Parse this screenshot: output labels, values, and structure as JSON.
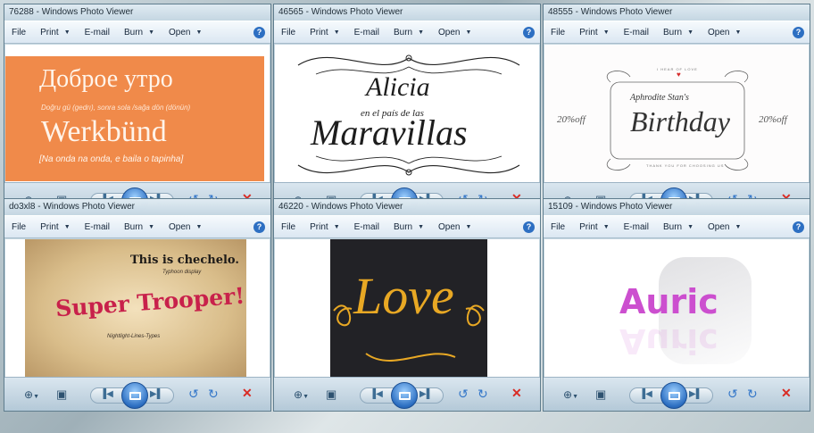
{
  "windows": [
    {
      "title": "76288 - Windows Photo Viewer",
      "menu": [
        "File",
        "Print",
        "E-mail",
        "Burn",
        "Open"
      ],
      "art": {
        "line1": "Доброе утро",
        "line2": "Doğru gü (gedrı), sonra sola /sağa dön (dönün)",
        "line3": "Werkbünd",
        "line4": "[Na onda na onda, e baila o tapinha]"
      }
    },
    {
      "title": "46565 - Windows Photo Viewer",
      "menu": [
        "File",
        "Print",
        "E-mail",
        "Burn",
        "Open"
      ],
      "art": {
        "line1": "Alicia",
        "line2": "en el país de las",
        "line3": "Maravillas"
      }
    },
    {
      "title": "48555 - Windows Photo Viewer",
      "menu": [
        "File",
        "Print",
        "E-mail",
        "Burn",
        "Open"
      ],
      "art": {
        "top": "I HEAR OF LOVE",
        "heart": "♥",
        "names": "Aphrodite Stan's",
        "main": "Birthday",
        "left": "20%off",
        "right": "20%off",
        "thanks": "THANK YOU FOR CHOOSING US"
      }
    },
    {
      "title": "do3xl8 - Windows Photo Viewer",
      "menu": [
        "File",
        "Print",
        "E-mail",
        "Burn",
        "Open"
      ],
      "art": {
        "line1": "This is chechelo.",
        "line2": "Typhoon display",
        "line3": "Super Trooper!",
        "line4": "Nightlight-Lines-Types"
      }
    },
    {
      "title": "46220 - Windows Photo Viewer",
      "menu": [
        "File",
        "Print",
        "E-mail",
        "Burn",
        "Open"
      ],
      "art": {
        "main": "Love"
      }
    },
    {
      "title": "15109 - Windows Photo Viewer",
      "menu": [
        "File",
        "Print",
        "E-mail",
        "Burn",
        "Open"
      ],
      "art": {
        "main": "Auric"
      }
    }
  ],
  "icons": {
    "help": "?",
    "caret": "▼",
    "zoom": "zoom-icon",
    "fit": "actual-size-icon",
    "prev": "previous-icon",
    "slideshow": "slideshow-icon",
    "next": "next-icon",
    "rotate_left": "rotate-left-icon",
    "rotate_right": "rotate-right-icon",
    "delete": "delete-icon"
  },
  "colors": {
    "accent": "#2d6fc2",
    "delete": "#d92b24",
    "art1_bg": "#f08a4a",
    "art6_text": "#cc4fcf",
    "art5_text": "#e8a824"
  }
}
